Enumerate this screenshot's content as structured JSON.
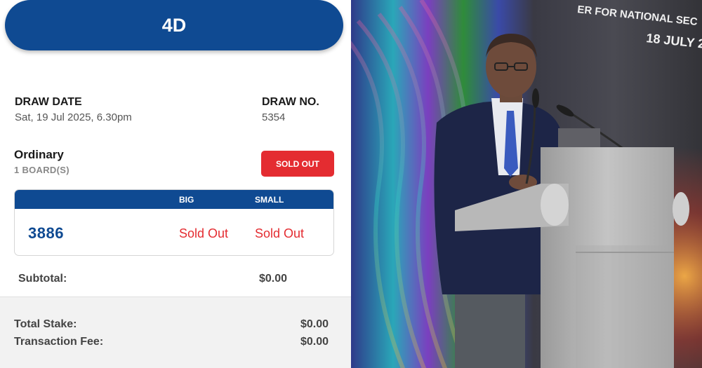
{
  "app": {
    "logo": "4D"
  },
  "draw": {
    "date_label": "DRAW DATE",
    "date_value": "Sat, 19 Jul 2025, 6.30pm",
    "no_label": "DRAW NO.",
    "no_value": "5354"
  },
  "bet": {
    "type": "Ordinary",
    "boards": "1 BOARD(S)",
    "badge": "SOLD OUT",
    "badge_color": "#e42c31",
    "columns": [
      "BIG",
      "SMALL"
    ],
    "number": "3886",
    "big": "Sold Out",
    "small": "Sold Out"
  },
  "subtotal": {
    "label": "Subtotal:",
    "value": "$0.00"
  },
  "summary": {
    "total_stake_label": "Total Stake:",
    "total_stake_value": "$0.00",
    "fee_label": "Transaction Fee:",
    "fee_value": "$0.00"
  },
  "photo": {
    "banner_line1": "ER FOR NATIONAL SEC",
    "banner_line2": "18 JULY 2"
  },
  "colors": {
    "brand_blue": "#0f4a92",
    "alert_red": "#e42c31"
  }
}
